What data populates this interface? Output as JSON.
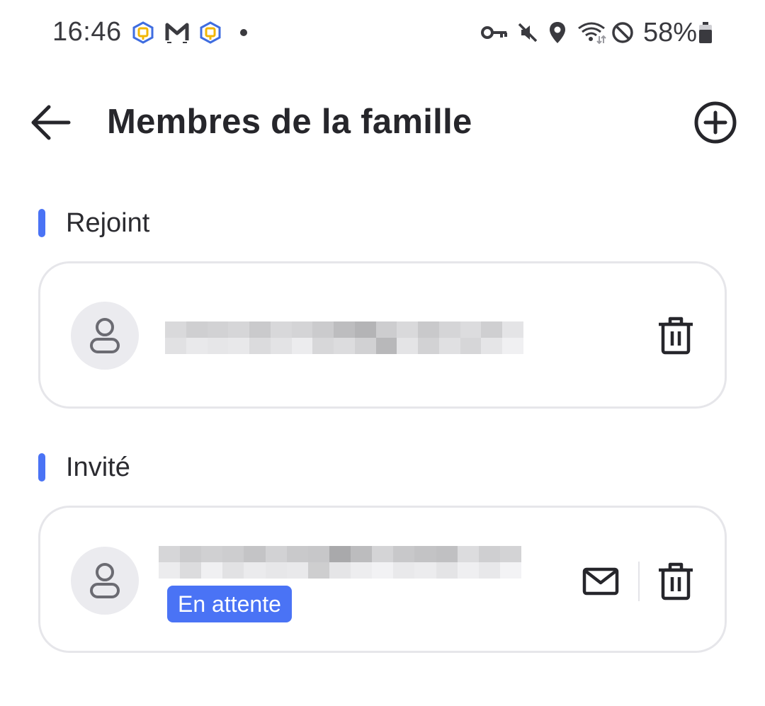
{
  "status_bar": {
    "time": "16:46",
    "battery": "58%",
    "left_icons": [
      "home-app-icon",
      "gmail-icon",
      "home-app-icon",
      "notification-dot-icon"
    ],
    "right_icons": [
      "vpn-key-icon",
      "mute-icon",
      "location-icon",
      "wifi-icon",
      "dnd-icon",
      "battery-icon"
    ]
  },
  "header": {
    "title": "Membres de la famille",
    "back_icon": "arrow-left-icon",
    "add_icon": "plus-circle-icon"
  },
  "sections": {
    "joined": {
      "label": "Rejoint",
      "member": {
        "name_redacted": true,
        "actions": [
          "trash-icon"
        ]
      }
    },
    "invited": {
      "label": "Invité",
      "member": {
        "name_redacted": true,
        "status": "En attente",
        "actions": [
          "mail-icon",
          "trash-icon"
        ]
      }
    }
  },
  "colors": {
    "accent": "#4a73f5",
    "text": "#26262b",
    "card_border": "#e6e6ea",
    "avatar_bg": "#ebebef"
  }
}
